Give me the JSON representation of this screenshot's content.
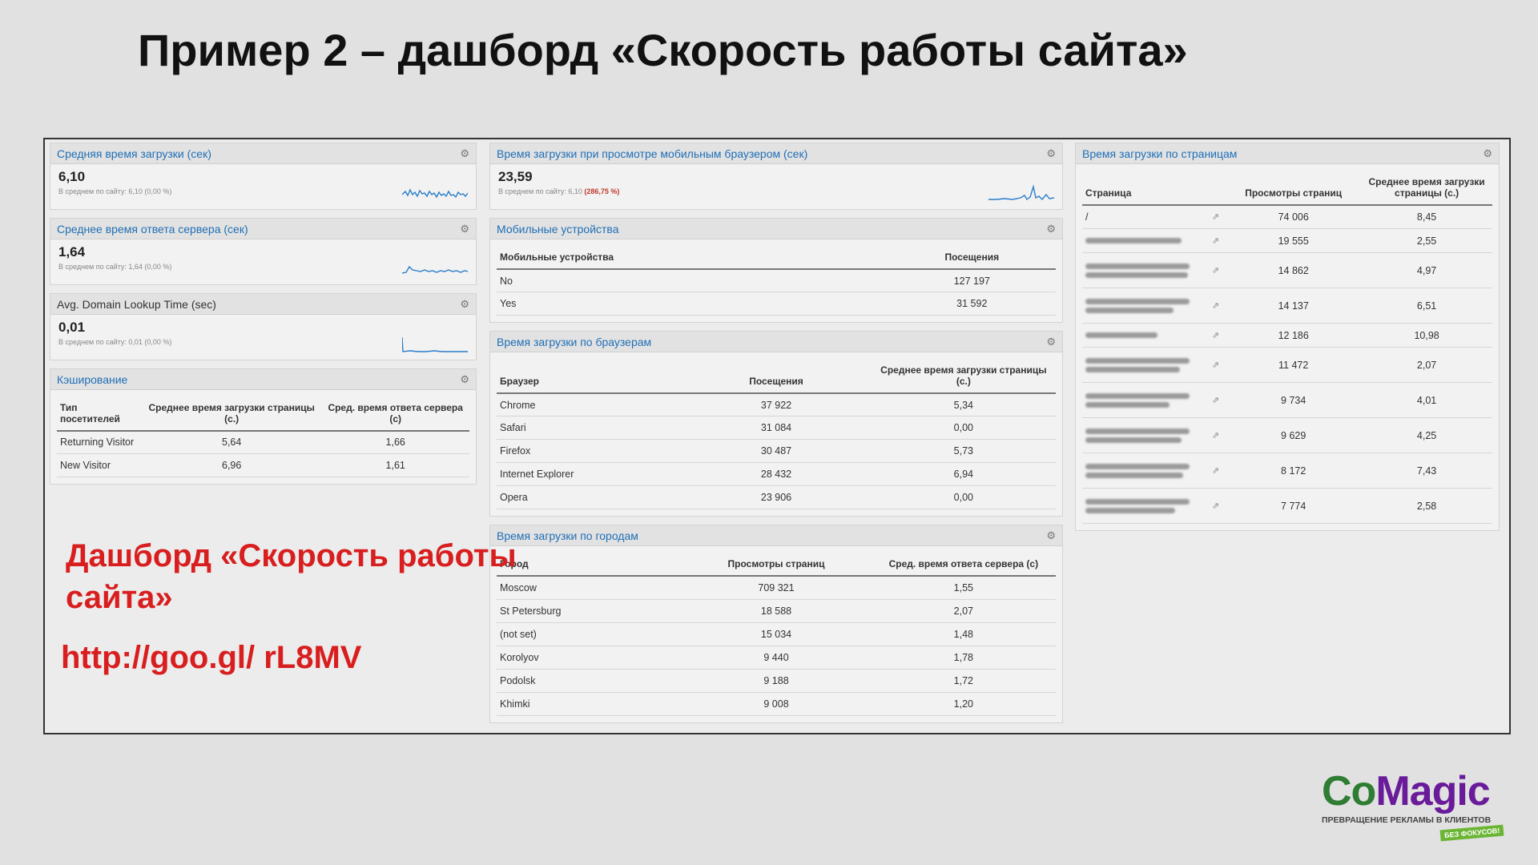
{
  "slide": {
    "title": "Пример 2 – дашборд «Скорость работы сайта»",
    "note_title": "Дашборд «Скорость работы сайта»",
    "note_url": "http://goo.gl/ rL8MV"
  },
  "widgets": {
    "avg_load": {
      "title": "Средняя время загрузки (сек)",
      "value": "6,10",
      "sub": "В среднем по сайту: 6,10 (0,00 %)"
    },
    "server_resp": {
      "title": "Среднее время ответа сервера (сек)",
      "value": "1,64",
      "sub": "В среднем по сайту: 1,64 (0,00 %)"
    },
    "domain_lookup": {
      "title": "Avg. Domain Lookup Time (sec)",
      "value": "0,01",
      "sub": "В среднем по сайту: 0,01 (0,00 %)"
    },
    "caching": {
      "title": "Кэширование",
      "headers": [
        "Тип посетителей",
        "Среднее время загрузки страницы (с.)",
        "Сред. время ответа сервера (с)"
      ],
      "rows": [
        [
          "Returning Visitor",
          "5,64",
          "1,66"
        ],
        [
          "New Visitor",
          "6,96",
          "1,61"
        ]
      ]
    },
    "mobile_load": {
      "title": "Время загрузки при просмотре мобильным браузером (сек)",
      "value": "23,59",
      "sub_prefix": "В среднем по сайту: 6,10",
      "sub_red": "(286,75 %)"
    },
    "mobile_devices": {
      "title": "Мобильные устройства",
      "headers": [
        "Мобильные устройства",
        "Посещения"
      ],
      "rows": [
        [
          "No",
          "127 197"
        ],
        [
          "Yes",
          "31 592"
        ]
      ]
    },
    "browsers": {
      "title": "Время загрузки по браузерам",
      "headers": [
        "Браузер",
        "Посещения",
        "Среднее время загрузки страницы (с.)"
      ],
      "rows": [
        [
          "Chrome",
          "37 922",
          "5,34"
        ],
        [
          "Safari",
          "31 084",
          "0,00"
        ],
        [
          "Firefox",
          "30 487",
          "5,73"
        ],
        [
          "Internet Explorer",
          "28 432",
          "6,94"
        ],
        [
          "Opera",
          "23 906",
          "0,00"
        ]
      ]
    },
    "cities": {
      "title": "Время загрузки по городам",
      "headers": [
        "Город",
        "Просмотры страниц",
        "Сред. время ответа сервера (с)"
      ],
      "rows": [
        [
          "Moscow",
          "709 321",
          "1,55"
        ],
        [
          "St Petersburg",
          "18 588",
          "2,07"
        ],
        [
          "(not set)",
          "15 034",
          "1,48"
        ],
        [
          "Korolyov",
          "9 440",
          "1,78"
        ],
        [
          "Podolsk",
          "9 188",
          "1,72"
        ],
        [
          "Khimki",
          "9 008",
          "1,20"
        ]
      ]
    },
    "pages": {
      "title": "Время загрузки по страницам",
      "headers": [
        "Страница",
        "Просмотры страниц",
        "Среднее время загрузки страницы (с.)"
      ],
      "first_page": "/",
      "rows": [
        [
          "74 006",
          "8,45"
        ],
        [
          "19 555",
          "2,55"
        ],
        [
          "14 862",
          "4,97"
        ],
        [
          "14 137",
          "6,51"
        ],
        [
          "12 186",
          "10,98"
        ],
        [
          "11 472",
          "2,07"
        ],
        [
          "9 734",
          "4,01"
        ],
        [
          "9 629",
          "4,25"
        ],
        [
          "8 172",
          "7,43"
        ],
        [
          "7 774",
          "2,58"
        ]
      ]
    }
  },
  "logo": {
    "name_part1": "Co",
    "name_part2": "Magic",
    "tagline": "ПРЕВРАЩЕНИЕ РЕКЛАМЫ В КЛИЕНТОВ",
    "badge": "БЕЗ ФОКУСОВ!"
  },
  "colors": {
    "accent_blue": "#1f6fb6",
    "note_red": "#d81e1e",
    "logo_green": "#2e7d32",
    "logo_purple": "#6a1b9a"
  }
}
